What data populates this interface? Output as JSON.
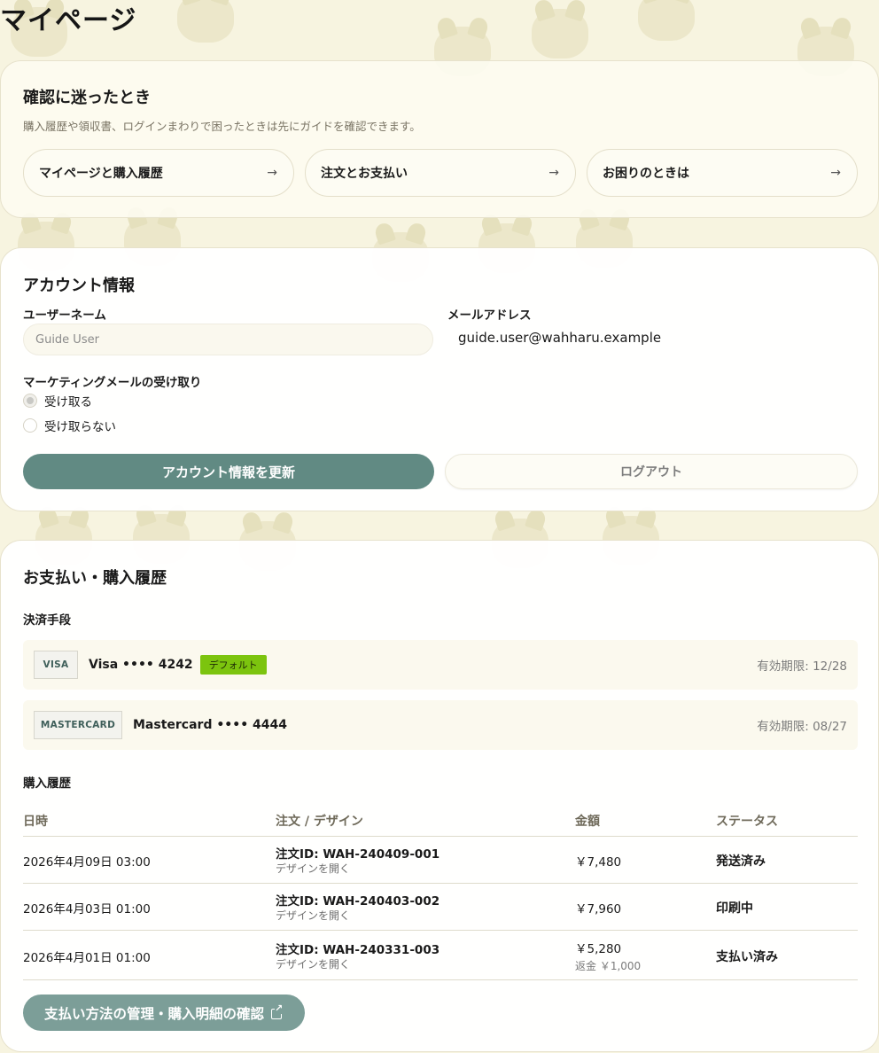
{
  "page": {
    "title": "マイページ"
  },
  "guide": {
    "title": "確認に迷ったとき",
    "description": "購入履歴や領収書、ログインまわりで困ったときは先にガイドを確認できます。",
    "links": [
      {
        "label": "マイページと購入履歴",
        "arrow": "→"
      },
      {
        "label": "注文とお支払い",
        "arrow": "→"
      },
      {
        "label": "お困りのときは",
        "arrow": "→"
      }
    ]
  },
  "account": {
    "title": "アカウント情報",
    "username_label": "ユーザーネーム",
    "username_placeholder": "Guide User",
    "username_value": "",
    "email_label": "メールアドレス",
    "email_value": "guide.user@wahharu.example",
    "marketing_label": "マーケティングメールの受け取り",
    "marketing_options": [
      {
        "label": "受け取る",
        "selected": true
      },
      {
        "label": "受け取らない",
        "selected": false
      }
    ],
    "update_button": "アカウント情報を更新",
    "logout_button": "ログアウト"
  },
  "payments": {
    "title": "お支払い・購入履歴",
    "methods_label": "決済手段",
    "methods": [
      {
        "brand": "VISA",
        "name": "Visa •••• 4242",
        "default_badge": "デフォルト",
        "is_default": true,
        "expiry": "有効期限: 12/28"
      },
      {
        "brand": "MASTERCARD",
        "name": "Mastercard •••• 4444",
        "default_badge": "",
        "is_default": false,
        "expiry": "有効期限: 08/27"
      }
    ],
    "history_label": "購入履歴",
    "columns": [
      "日時",
      "注文 / デザイン",
      "金額",
      "ステータス"
    ],
    "orders": [
      {
        "date": "2026年4月09日 03:00",
        "order_id": "注文ID: WAH-240409-001",
        "design_link": "デザインを開く",
        "amount": "￥7,480",
        "refund": "",
        "status": "発送済み"
      },
      {
        "date": "2026年4月03日 01:00",
        "order_id": "注文ID: WAH-240403-002",
        "design_link": "デザインを開く",
        "amount": "￥7,960",
        "refund": "",
        "status": "印刷中"
      },
      {
        "date": "2026年4月01日 01:00",
        "order_id": "注文ID: WAH-240331-003",
        "design_link": "デザインを開く",
        "amount": "￥5,280",
        "refund": "返金 ￥1,000",
        "status": "支払い済み"
      }
    ],
    "manage_button": "支払い方法の管理・購入明細の確認"
  },
  "colors": {
    "background": "#f7f4e0",
    "primary_button": "#618a83",
    "manage_button": "#7c9e98",
    "default_badge": "#7cc40e"
  },
  "icons": {
    "guide_link": "arrow-right-icon",
    "manage_button": "external-link-icon",
    "background": "animal-pattern"
  }
}
